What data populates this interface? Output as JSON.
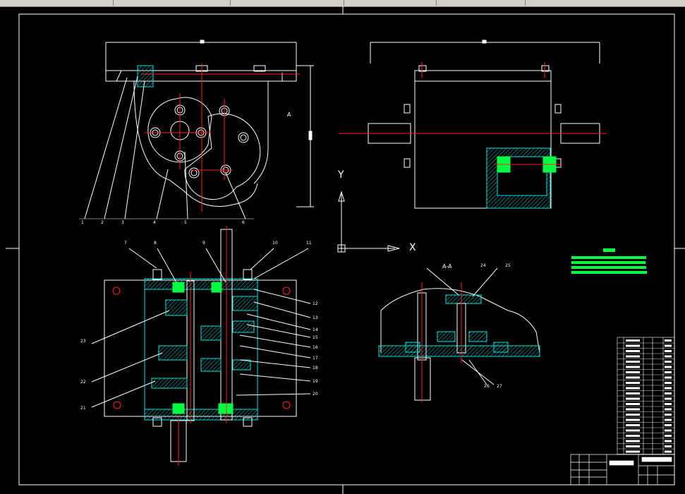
{
  "toolbar": {
    "segments": [
      "",
      "",
      "",
      "",
      ""
    ]
  },
  "colors": {
    "background": "#000000",
    "outline": "#ffffff",
    "centerline": "#ff2020",
    "section": "#00e0e0",
    "bearing": "#00ff40",
    "hatch": "#00c8c8"
  },
  "ucs": {
    "y_label": "Y",
    "x_label": "X"
  },
  "views": {
    "section_label": "A-A",
    "front_marker": "A"
  },
  "balloons": {
    "top_left": [
      "1",
      "2",
      "3",
      "4",
      "5",
      "6"
    ],
    "left_side": [
      "23",
      "22",
      "21"
    ],
    "top_row": [
      "7",
      "8",
      "9",
      "10",
      "11"
    ],
    "right_side": [
      "12",
      "13",
      "14",
      "15",
      "16",
      "17",
      "18",
      "19",
      "20"
    ],
    "section": [
      "24",
      "25",
      "26",
      "27"
    ]
  },
  "title_block": {
    "title": "",
    "drawing_name": ""
  },
  "legend_header": ""
}
